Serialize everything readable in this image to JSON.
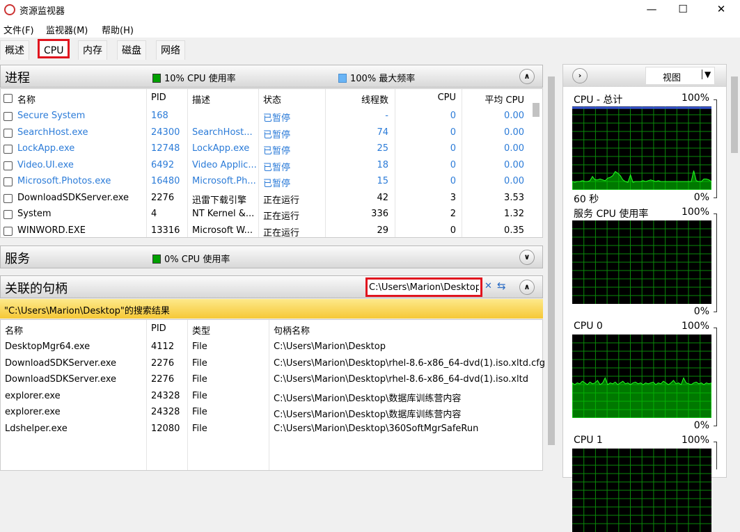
{
  "window": {
    "title": "资源监视器",
    "minimize": "—",
    "maximize": "☐",
    "close": "✕"
  },
  "menu": [
    "文件(F)",
    "监视器(M)",
    "帮助(H)"
  ],
  "tabs": [
    {
      "label": "概述"
    },
    {
      "label": "CPU",
      "selected": true
    },
    {
      "label": "内存"
    },
    {
      "label": "磁盘"
    },
    {
      "label": "网络"
    }
  ],
  "processes": {
    "title": "进程",
    "cpu_usage": "10% CPU 使用率",
    "max_freq": "100% 最大频率",
    "cpu_color": "#00a000",
    "freq_color": "#69b4f5",
    "columns": [
      "名称",
      "PID",
      "描述",
      "状态",
      "线程数",
      "CPU",
      "平均 CPU"
    ],
    "rows": [
      [
        "Secure System",
        "168",
        "",
        "已暂停",
        "-",
        "0",
        "0.00",
        true
      ],
      [
        "SearchHost.exe",
        "24300",
        "SearchHost...",
        "已暂停",
        "74",
        "0",
        "0.00",
        true
      ],
      [
        "LockApp.exe",
        "12748",
        "LockApp.exe",
        "已暂停",
        "25",
        "0",
        "0.00",
        true
      ],
      [
        "Video.UI.exe",
        "6492",
        "Video Applic...",
        "已暂停",
        "18",
        "0",
        "0.00",
        true
      ],
      [
        "Microsoft.Photos.exe",
        "16480",
        "Microsoft.Ph...",
        "已暂停",
        "15",
        "0",
        "0.00",
        true
      ],
      [
        "DownloadSDKServer.exe",
        "2276",
        "迅雷下载引擎",
        "正在运行",
        "42",
        "3",
        "3.53",
        false
      ],
      [
        "System",
        "4",
        "NT Kernel &...",
        "正在运行",
        "336",
        "2",
        "1.32",
        false
      ],
      [
        "WINWORD.EXE",
        "13316",
        "Microsoft W...",
        "正在运行",
        "29",
        "0",
        "0.35",
        false
      ]
    ]
  },
  "services": {
    "title": "服务",
    "cpu_usage": "0% CPU 使用率"
  },
  "handles": {
    "title": "关联的句柄",
    "search_value": "C:\\Users\\Marion\\Desktop",
    "result_banner": "\"C:\\Users\\Marion\\Desktop\"的搜索结果",
    "columns": [
      "名称",
      "PID",
      "类型",
      "句柄名称"
    ],
    "rows": [
      [
        "DesktopMgr64.exe",
        "4112",
        "File",
        "C:\\Users\\Marion\\Desktop"
      ],
      [
        "DownloadSDKServer.exe",
        "2276",
        "File",
        "C:\\Users\\Marion\\Desktop\\rhel-8.6-x86_64-dvd(1).iso.xltd.cfg"
      ],
      [
        "DownloadSDKServer.exe",
        "2276",
        "File",
        "C:\\Users\\Marion\\Desktop\\rhel-8.6-x86_64-dvd(1).iso.xltd"
      ],
      [
        "explorer.exe",
        "24328",
        "File",
        "C:\\Users\\Marion\\Desktop\\数据库训练营内容"
      ],
      [
        "explorer.exe",
        "24328",
        "File",
        "C:\\Users\\Marion\\Desktop\\数据库训练营内容"
      ],
      [
        "Ldshelper.exe",
        "12080",
        "File",
        "C:\\Users\\Marion\\Desktop\\360SoftMgrSafeRun"
      ]
    ]
  },
  "right": {
    "view_label": "视图",
    "graphs": [
      {
        "label": "CPU - 总计",
        "max": "100%",
        "min": "0%",
        "time": "60 秒",
        "values": [
          10,
          9,
          10,
          10,
          11,
          10,
          10,
          11,
          16,
          12,
          12,
          13,
          12,
          11,
          14,
          15,
          17,
          22,
          20,
          17,
          12,
          10,
          9,
          18,
          9,
          10,
          10,
          10,
          11,
          10,
          11,
          12,
          11,
          10,
          11,
          10,
          10,
          10,
          10,
          10,
          10,
          10,
          10,
          10,
          10,
          10,
          10,
          10,
          23,
          11,
          10,
          10,
          13,
          13,
          12,
          10
        ],
        "freq": 100
      },
      {
        "label": "服务 CPU 使用率",
        "max": "100%",
        "min": "0%",
        "values": []
      },
      {
        "label": "CPU 0",
        "max": "100%",
        "min": "0%",
        "values": [
          42,
          40,
          42,
          41,
          44,
          42,
          40,
          43,
          41,
          42,
          45,
          40,
          42,
          48,
          40,
          42,
          41,
          43,
          40,
          42,
          44,
          41,
          42,
          40,
          42,
          43,
          41,
          42,
          40,
          42,
          41,
          42,
          43,
          40,
          42,
          41,
          44,
          42,
          40,
          42,
          45,
          41,
          42,
          40,
          48,
          42,
          41,
          40,
          42,
          43,
          41,
          42,
          40,
          42,
          41,
          42
        ]
      },
      {
        "label": "CPU 1",
        "max": "100%",
        "values": []
      }
    ]
  }
}
